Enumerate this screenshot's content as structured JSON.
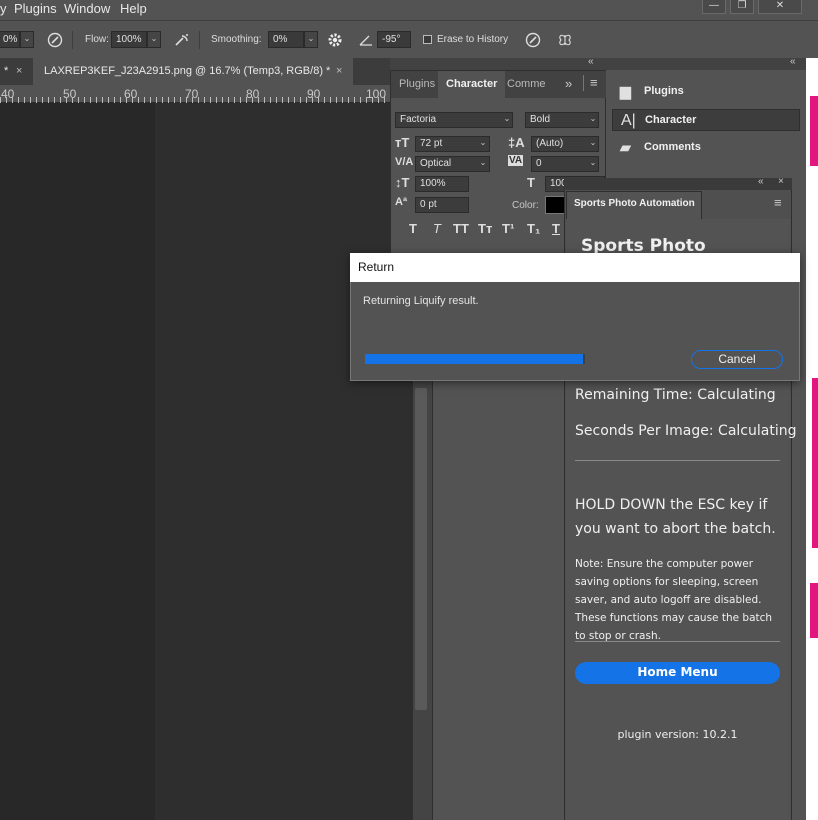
{
  "menu": {
    "items": [
      "Plugins",
      "Window",
      "Help"
    ],
    "partial_left": "y"
  },
  "window_controls": {
    "minimize": "—",
    "restore": "❐",
    "close": "✕"
  },
  "options": {
    "zoom_value": "0%",
    "flow_label": "Flow:",
    "flow_value": "100%",
    "smoothing_label": "Smoothing:",
    "smoothing_value": "0%",
    "angle_value": "-95°",
    "erase_to_history_label": "Erase to History"
  },
  "document": {
    "prev_tab_label": "*",
    "tab_label": "LAXREP3KEF_J23A2915.png @ 16.7% (Temp3, RGB/8) *",
    "close_glyph": "×"
  },
  "ruler": {
    "labels": [
      "40",
      "50",
      "60",
      "70",
      "80",
      "90",
      "100"
    ]
  },
  "character_panel": {
    "tabs": [
      "Plugins",
      "Character",
      "Comme"
    ],
    "overflow": "»",
    "font_family": "Factoria",
    "font_style": "Bold",
    "font_size": "72 pt",
    "leading": "(Auto)",
    "kerning": "Optical",
    "tracking": "0",
    "vertical_scale": "100%",
    "horizontal_scale": "100",
    "baseline_shift": "0 pt",
    "color_label": "Color:",
    "color": "#000000"
  },
  "icon_panel": {
    "items": [
      "Plugins",
      "Character",
      "Comments"
    ],
    "selected": "Character"
  },
  "spa_panel": {
    "tab_label": "Sports Photo Automation",
    "heading": "Sports Photo Automation",
    "remaining_time": "Remaining Time: Calculating",
    "seconds_per_image": "Seconds Per Image: Calculating",
    "esc_notice": "HOLD DOWN the ESC key if you want to abort the batch.",
    "note": "Note: Ensure the computer power saving options for sleeping, screen saver, and auto logoff are disabled. These functions may cause the batch to stop or crash.",
    "home_button": "Home Menu",
    "plugin_version": "plugin version: 10.2.1"
  },
  "dialog": {
    "title": "Return",
    "message": "Returning Liquify result.",
    "progress_fraction": 0.99,
    "cancel_label": "Cancel"
  },
  "colors": {
    "accent": "#1473e6",
    "magenta_edge": "#e3157e"
  }
}
